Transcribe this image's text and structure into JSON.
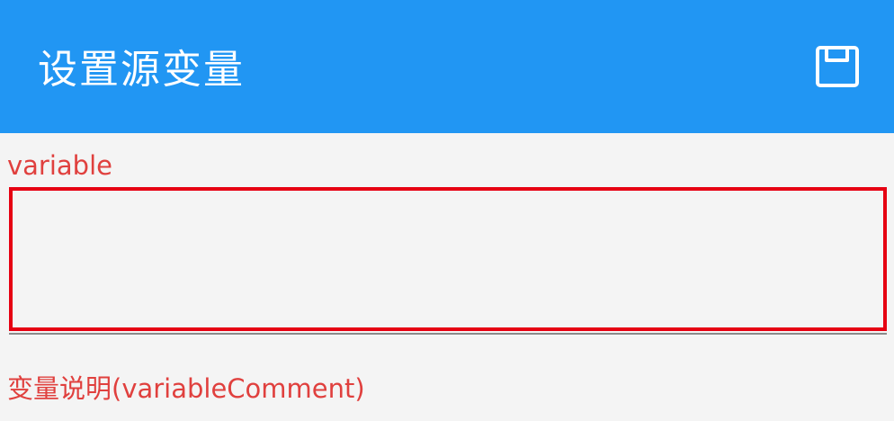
{
  "app_bar": {
    "title": "设置源变量",
    "save_icon": "save-icon",
    "background_color": "#2196f3"
  },
  "form": {
    "variable": {
      "label": "variable",
      "value": ""
    },
    "variable_comment": {
      "label": "变量说明(variableComment)"
    },
    "label_color": "#e0403e",
    "highlight_color": "#e60012"
  }
}
